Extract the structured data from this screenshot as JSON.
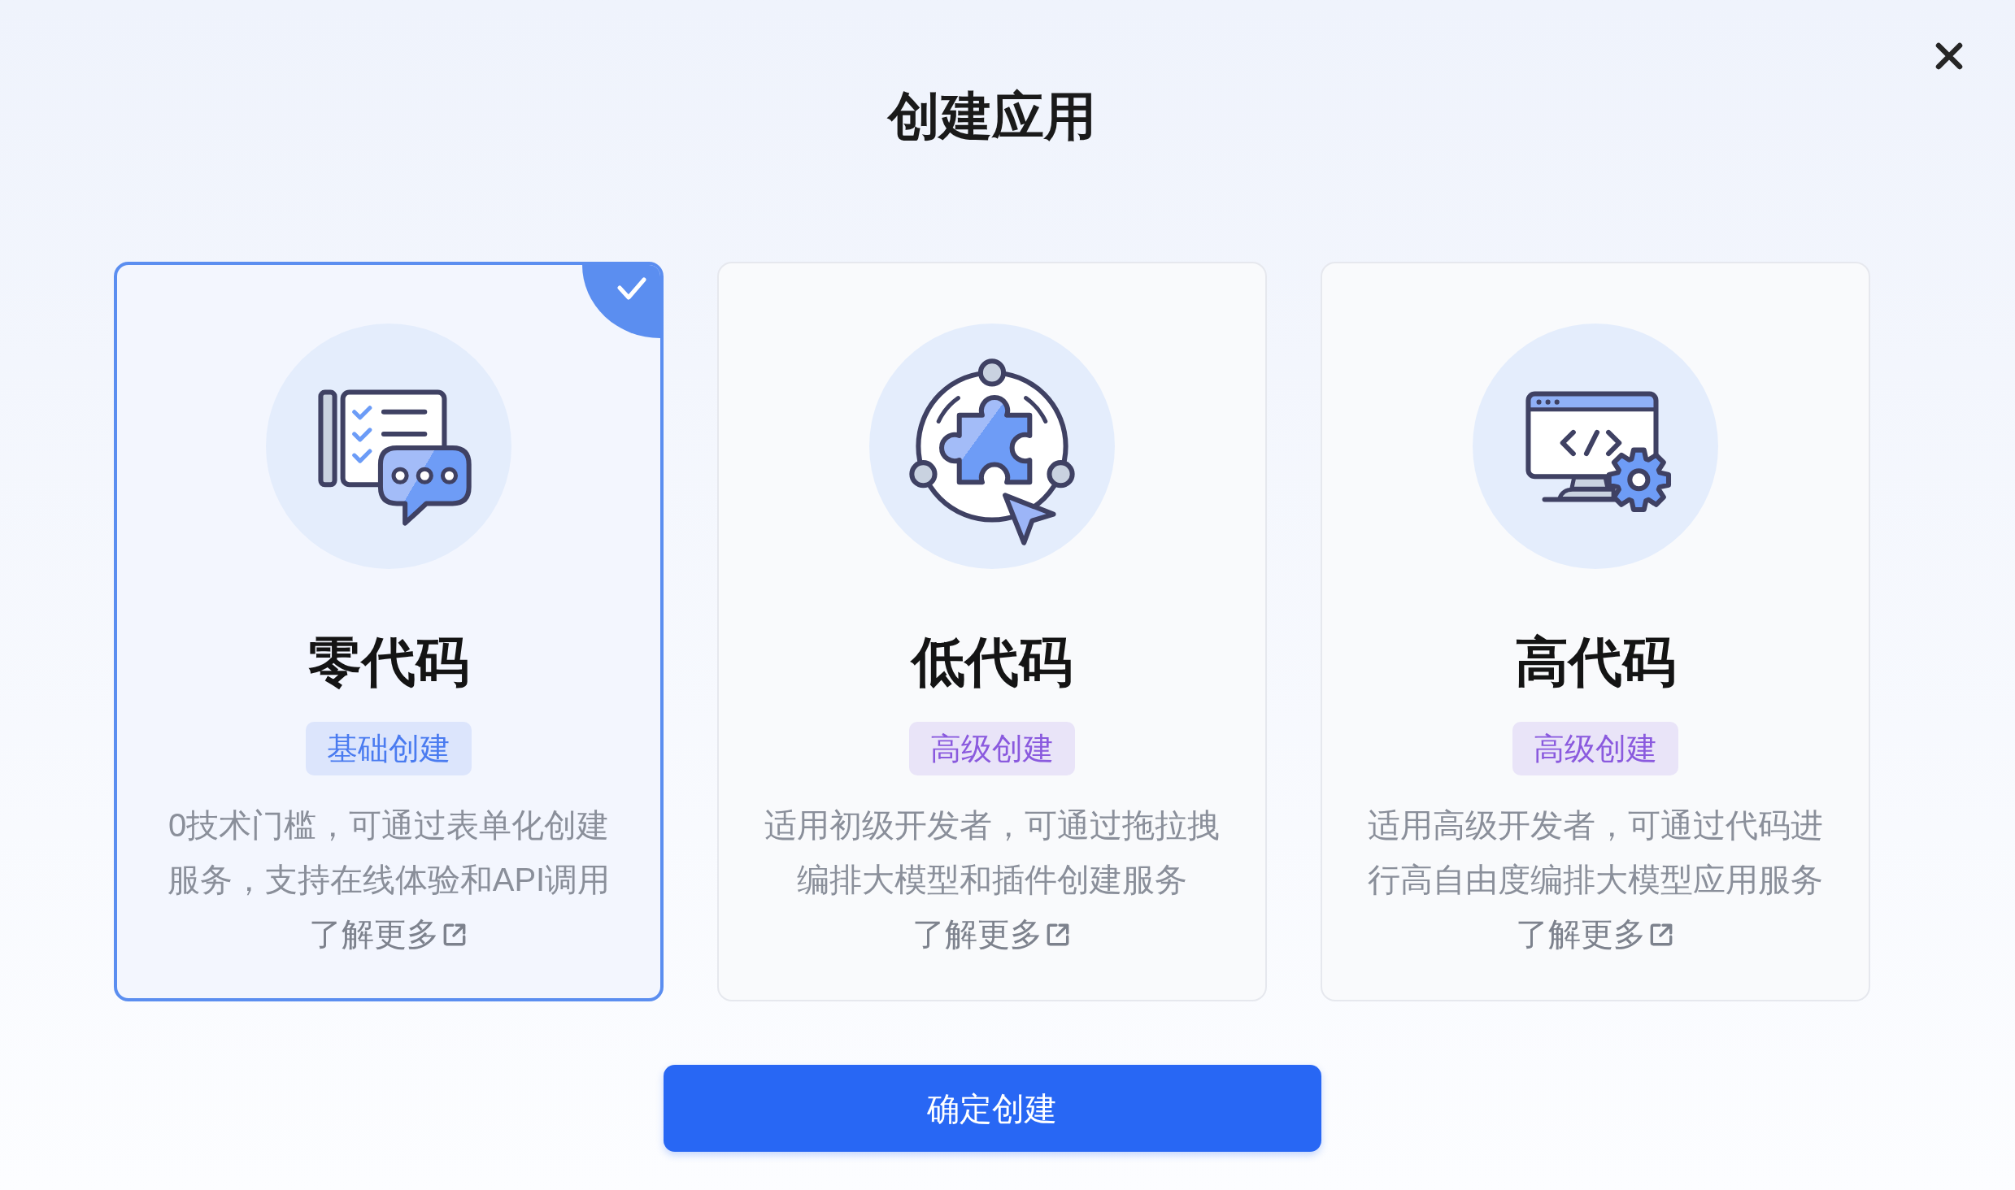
{
  "dialog": {
    "title": "创建应用",
    "confirm_button": "确定创建"
  },
  "cards": [
    {
      "kind": "form",
      "title": "零代码",
      "tag": {
        "text": "基础创建",
        "color": "#4a7bf0"
      },
      "description": "0技术门槛，可通过表单化创建服务，支持在线体验和API调用",
      "link": "了解更多",
      "selected": true
    },
    {
      "kind": "plugin",
      "title": "低代码",
      "tag": {
        "text": "高级创建",
        "color": "#8a5ade"
      },
      "description": "适用初级开发者，可通过拖拉拽编排大模型和插件创建服务",
      "link": "了解更多",
      "selected": false
    },
    {
      "kind": "code",
      "title": "高代码",
      "tag": {
        "text": "高级创建",
        "color": "#8a5ade"
      },
      "description": "适用高级开发者，可通过代码进行高自由度编排大模型应用服务",
      "link": "了解更多",
      "selected": false
    }
  ]
}
